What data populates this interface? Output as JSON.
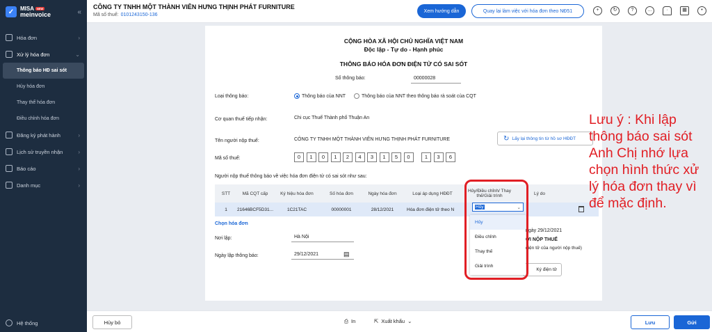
{
  "sidebar": {
    "logo_line1": "MISA",
    "logo_line2": "meinvoice",
    "logo_badge": "NEW",
    "items": [
      {
        "label": "Hóa đơn"
      },
      {
        "label": "Xử lý hóa đơn"
      },
      {
        "label": "Đăng ký phát hành"
      },
      {
        "label": "Lịch sử truyền nhận"
      },
      {
        "label": "Báo cáo"
      },
      {
        "label": "Danh mục"
      }
    ],
    "sub_items": [
      {
        "label": "Thông báo HĐ sai sót"
      },
      {
        "label": "Hủy hóa đơn"
      },
      {
        "label": "Thay thế hóa đơn"
      },
      {
        "label": "Điều chỉnh hóa đơn"
      }
    ],
    "system_label": "Hệ thống"
  },
  "header": {
    "company": "CÔNG TY TNHH MỘT THÀNH VIÊN HƯNG THỊNH PHÁT FURNITURE",
    "tax_label": "Mã số thuế:",
    "tax_code": "0101243150-136",
    "guide_button": "Xem hướng dẫn",
    "back_button": "Quay lại làm việc với hóa đơn theo NĐ51"
  },
  "form": {
    "title1": "CỘNG HÒA XÃ HỘI CHỦ NGHĨA VIỆT NAM",
    "title2": "Độc lập - Tự do - Hạnh phúc",
    "title3": "THÔNG BÁO HÓA ĐƠN ĐIỆN TỬ CÓ SAI SÓT",
    "number_label": "Số thông báo:",
    "number_value": "00000028",
    "type_label": "Loại thông báo:",
    "type_option1": "Thông báo của NNT",
    "type_option2": "Thông báo của NNT theo thông báo rà soát của CQT",
    "agency_label": "Cơ quan thuế tiếp nhận:",
    "agency_value": "Chi cục Thuế Thành phố Thuận An",
    "taxpayer_label": "Tên người nộp thuế:",
    "taxpayer_value": "CÔNG TY TNHH MỘT THÀNH VIÊN HƯNG THỊNH PHÁT FURNITURE",
    "reload_button": "Lấy lại thông tin từ hồ sơ HĐĐT",
    "taxcode_label": "Mã số thuế:",
    "taxcode_digits": [
      "0",
      "1",
      "0",
      "1",
      "2",
      "4",
      "3",
      "1",
      "5",
      "0",
      "1",
      "3",
      "6"
    ],
    "notice_text": "Người nộp thuế thông báo về việc hóa đơn điện tử có sai sót như sau:",
    "choose_invoice": "Chọn hóa đơn",
    "place_label": "Nơi lập:",
    "place_value": "Hà Nội",
    "date_label": "Ngày lập thông báo:",
    "date_value": "29/12/2021",
    "behind_text1": "ngày 29/12/2021",
    "behind_text2": "ỜI NỘP THUẾ",
    "behind_text3": "điện tử của người nộp thuế)",
    "sign_button": "Ký điện tử"
  },
  "table": {
    "headers": [
      "STT",
      "Mã CQT cấp",
      "Ký hiệu hóa đơn",
      "Số hóa đơn",
      "Ngày hóa đơn",
      "Loại áp dụng HĐĐT",
      "Hủy/Điều chỉnh/ Thay thế/Giải trình",
      "Lý do"
    ],
    "row": [
      "1",
      "21646BCF5D31...",
      "1C21TAC",
      "00000001",
      "28/12/2021",
      "Hóa đơn điện tử theo N"
    ],
    "dropdown_value": "Hủy",
    "options": [
      "Hủy",
      "Điều chỉnh",
      "Thay thế",
      "Giải trình"
    ]
  },
  "note": "Lưu ý : Khi lập thông báo sai sót Anh Chị nhớ lựa chọn hình thức xử lý hóa đơn thay vì để mặc định.",
  "footer": {
    "cancel": "Hủy bỏ",
    "print": "In",
    "export": "Xuất khẩu",
    "save": "Lưu",
    "send": "Gửi"
  }
}
